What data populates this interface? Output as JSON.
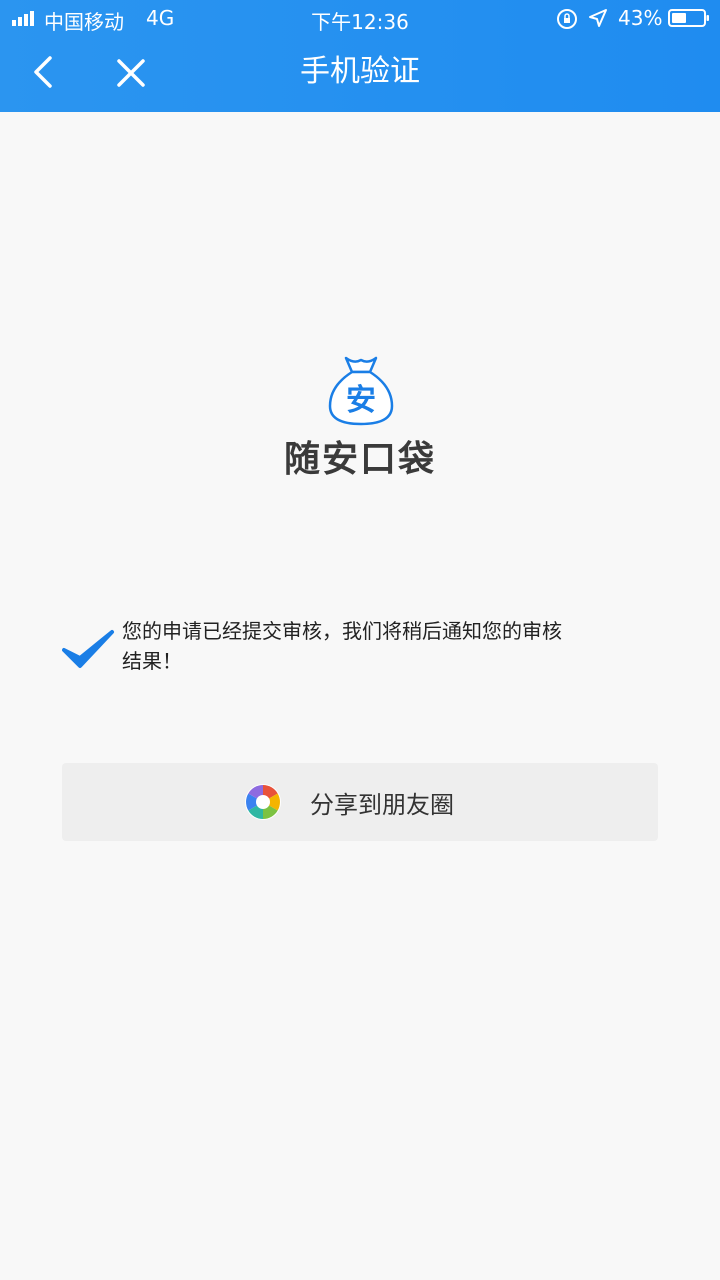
{
  "status_bar": {
    "carrier": "中国移动",
    "network": "4G",
    "time": "下午12:36",
    "battery": "43%"
  },
  "nav": {
    "title": "手机验证"
  },
  "brand": {
    "logo_char": "安",
    "name": "随安口袋"
  },
  "message": {
    "text": "您的申请已经提交审核，我们将稍后通知您的审核结果！"
  },
  "share": {
    "label": "分享到朋友圈"
  },
  "colors": {
    "header": "#1f8cf0",
    "accent": "#1a7ee6"
  }
}
